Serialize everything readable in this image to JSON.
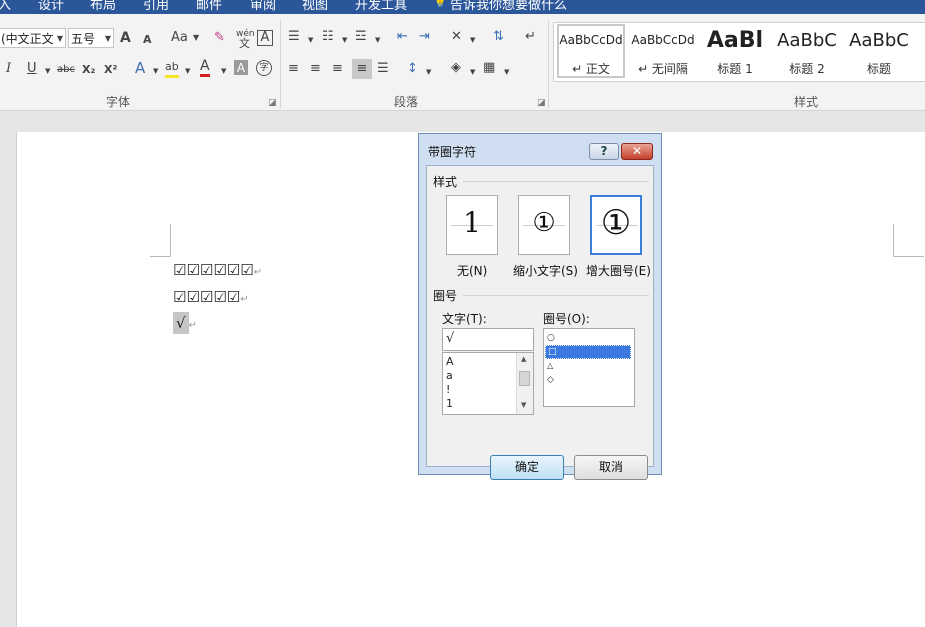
{
  "menu": {
    "items": [
      "入",
      "设计",
      "布局",
      "引用",
      "邮件",
      "审阅",
      "视图",
      "开发工具"
    ],
    "tell_me": "告诉我你想要做什么"
  },
  "ribbon": {
    "font": {
      "group_label": "字体",
      "font_name": "(中文正文",
      "font_size": "五号",
      "grow": "A",
      "shrink": "A",
      "change_case": "Aa",
      "phonetic": "wén",
      "phonetic_char": "文",
      "border_char": "A",
      "italic": "I",
      "underline": "U",
      "strikethrough": "abc",
      "subscript": "X₂",
      "superscript": "X²",
      "text_effects": "A",
      "highlight": "ab",
      "font_color": "A",
      "char_shading": "A",
      "enclose_char": "字"
    },
    "paragraph": {
      "group_label": "段落"
    },
    "styles": {
      "group_label": "样式",
      "items": [
        {
          "preview": "AaBbCcDd",
          "name": "↵ 正文"
        },
        {
          "preview": "AaBbCcDd",
          "name": "↵ 无间隔"
        },
        {
          "preview": "AaBl",
          "name": "标题 1"
        },
        {
          "preview": "AaBbC",
          "name": "标题 2"
        },
        {
          "preview": "AaBbC",
          "name": "标题"
        }
      ]
    }
  },
  "document": {
    "lines": [
      {
        "text": "☑☑☑☑☑☑",
        "mark": "↵"
      },
      {
        "text": "☑☑☑☑☑",
        "mark": "↵"
      },
      {
        "text": "√",
        "mark": "↵"
      }
    ]
  },
  "dialog": {
    "title": "带圈字符",
    "help": "?",
    "close": "✕",
    "style_section": "样式",
    "style_options": [
      {
        "glyph": "1",
        "label": "无(N)"
      },
      {
        "glyph": "①",
        "label": "缩小文字(S)"
      },
      {
        "glyph": "①",
        "label": "增大圈号(E)"
      }
    ],
    "enclosure_section": "圈号",
    "text_label": "文字(T):",
    "text_value": "√",
    "text_list": [
      "A",
      "a",
      "!",
      "1"
    ],
    "enclosure_label": "圈号(O):",
    "enclosure_list": [
      "○",
      "□",
      "△",
      "◇"
    ],
    "ok": "确定",
    "cancel": "取消"
  }
}
